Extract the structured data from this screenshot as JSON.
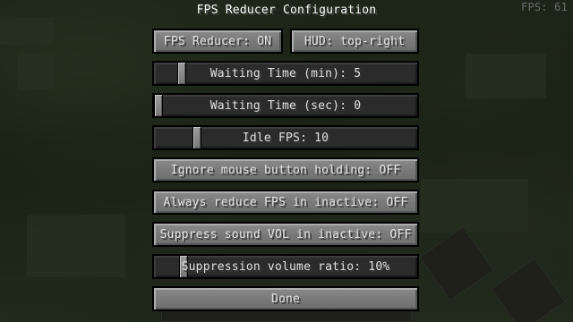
{
  "screen": {
    "title": "FPS Reducer Configuration",
    "fps_counter": "FPS: 61"
  },
  "buttons": {
    "fps_reducer": "FPS Reducer: ON",
    "hud": "HUD: top-right",
    "ignore_mouse": "Ignore mouse button holding: OFF",
    "always_reduce": "Always reduce FPS in inactive: OFF",
    "suppress_sound": "Suppress sound VOL in inactive: OFF",
    "done": "Done"
  },
  "sliders": {
    "waiting_min": {
      "label": "Waiting Time (min): 5",
      "fraction": 0.09
    },
    "waiting_sec": {
      "label": "Waiting Time (sec): 0",
      "fraction": 0.0
    },
    "idle_fps": {
      "label": "Idle FPS: 10",
      "fraction": 0.15
    },
    "volume_ratio": {
      "label": "Suppression volume ratio: 10%",
      "fraction": 0.1
    }
  }
}
